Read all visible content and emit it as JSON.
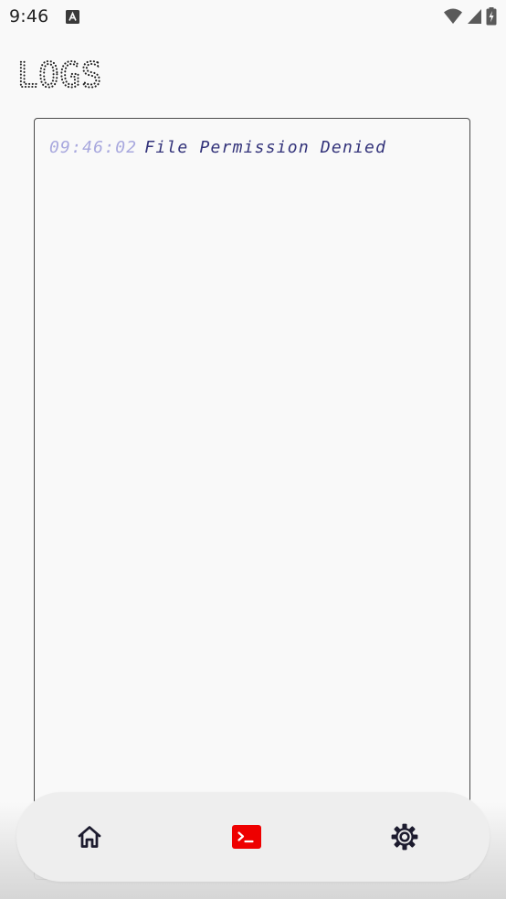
{
  "status_bar": {
    "time": "9:46",
    "icons": [
      "accessibility-a-icon",
      "wifi-icon",
      "cellular-signal-icon",
      "battery-charging-icon"
    ]
  },
  "page": {
    "title": "LOGS"
  },
  "logs": [
    {
      "time": "09:46:02",
      "message": "File Permission Denied"
    }
  ],
  "bottom_nav": {
    "items": [
      {
        "id": "home",
        "icon": "home-icon",
        "active": false
      },
      {
        "id": "logs",
        "icon": "terminal-icon",
        "active": true
      },
      {
        "id": "settings",
        "icon": "gear-icon",
        "active": false
      }
    ]
  },
  "colors": {
    "background": "#f9f9f9",
    "accent_active": "#ee0000",
    "log_time": "#a8a8de",
    "log_message": "#33337a",
    "icon_dark": "#1c1b2e"
  }
}
